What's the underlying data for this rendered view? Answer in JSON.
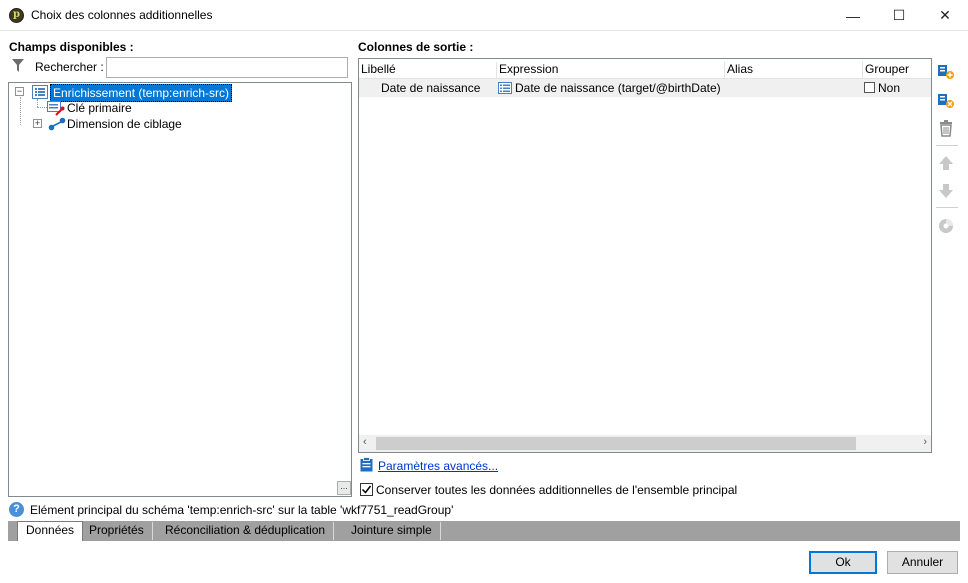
{
  "window": {
    "title": "Choix des colonnes additionnelles",
    "minimize": "—",
    "maximize": "☐",
    "close": "✕"
  },
  "left": {
    "label": "Champs disponibles :",
    "search_label": "Rechercher :",
    "search_value": "",
    "tree": [
      {
        "label": "Enrichissement (temp:enrich-src)",
        "icon": "list-icon",
        "expanded": true,
        "selected": true
      },
      {
        "label": "Clé primaire",
        "icon": "primary-key-icon"
      },
      {
        "label": "Dimension de ciblage",
        "icon": "link-icon",
        "expanded": false
      }
    ],
    "corner_button": "…"
  },
  "right": {
    "label": "Colonnes de sortie :",
    "columns": [
      "Libellé",
      "Expression",
      "Alias",
      "Grouper"
    ],
    "rows": [
      {
        "libelle": "Date de naissance",
        "expression": "Date de naissance (target/@birthDate)",
        "alias": "",
        "grouper": "Non"
      }
    ],
    "advanced_link": "Paramètres avancés...",
    "keep_all_label": "Conserver toutes les données additionnelles de l'ensemble principal",
    "keep_all_checked": true
  },
  "status": {
    "text": "Elément principal du schéma 'temp:enrich-src' sur la table 'wkf7751_readGroup'"
  },
  "tabs": [
    {
      "label": "Données",
      "active": true
    },
    {
      "label": "Propriétés"
    },
    {
      "label": "Réconciliation & déduplication"
    },
    {
      "label": "Jointure simple"
    }
  ],
  "footer": {
    "ok": "Ok",
    "cancel": "Annuler"
  },
  "colors": {
    "selection": "#0078d7",
    "tab_bar": "#a0a0a0",
    "link": "#0033cc",
    "accent_orange": "#f39c12",
    "accent_blue": "#1e6fbf"
  }
}
